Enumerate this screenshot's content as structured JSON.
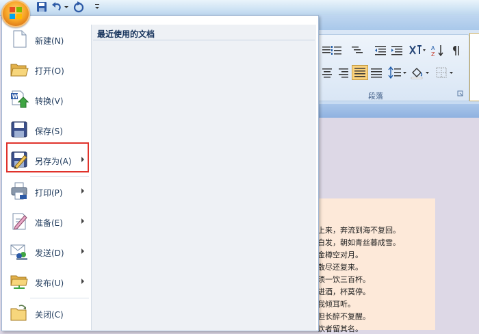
{
  "menu": {
    "recent_title": "最近使用的文档",
    "items": [
      {
        "label": "新建(N)",
        "icon": "new-document-icon"
      },
      {
        "label": "打开(O)",
        "icon": "open-folder-icon"
      },
      {
        "label": "转换(V)",
        "icon": "convert-icon"
      },
      {
        "label": "保存(S)",
        "icon": "save-icon"
      },
      {
        "label": "另存为(A)",
        "icon": "save-as-icon"
      },
      {
        "label": "打印(P)",
        "icon": "print-icon"
      },
      {
        "label": "准备(E)",
        "icon": "prepare-icon"
      },
      {
        "label": "发送(D)",
        "icon": "send-icon"
      },
      {
        "label": "发布(U)",
        "icon": "publish-icon"
      },
      {
        "label": "关闭(C)",
        "icon": "close-folder-icon"
      }
    ]
  },
  "ribbon": {
    "paragraph_label": "段落"
  },
  "document": {
    "lines": [
      "上来，奔流到海不复回。",
      "白发，朝如青丝暮成雪。",
      "金樽空对月。",
      "散尽还复来。",
      "须一饮三百杯。",
      "进酒，杯莫停。",
      "我倾耳听。",
      "但长醉不复醒。",
      "饮者留其名。"
    ]
  },
  "colors": {
    "highlight": "#e0322b",
    "accent": "#f7a526"
  }
}
